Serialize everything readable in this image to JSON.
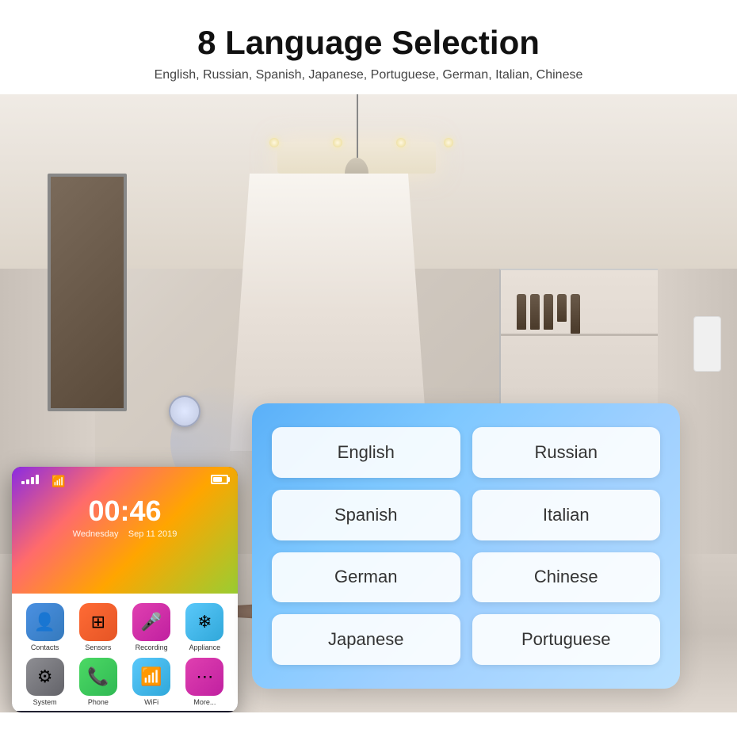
{
  "header": {
    "title": "8 Language Selection",
    "subtitle": "English, Russian, Spanish, Japanese, Portuguese, German, Italian, Chinese"
  },
  "languages": [
    {
      "id": "english",
      "label": "English"
    },
    {
      "id": "russian",
      "label": "Russian"
    },
    {
      "id": "spanish",
      "label": "Spanish"
    },
    {
      "id": "italian",
      "label": "Italian"
    },
    {
      "id": "german",
      "label": "German"
    },
    {
      "id": "chinese",
      "label": "Chinese"
    },
    {
      "id": "japanese",
      "label": "Japanese"
    },
    {
      "id": "portuguese",
      "label": "Portuguese"
    }
  ],
  "phone": {
    "time": "00:46",
    "date_line1": "Wednesday",
    "date_line2": "Sep 11 2019",
    "apps": [
      {
        "id": "contacts",
        "label": "Contacts",
        "icon": "👤"
      },
      {
        "id": "sensors",
        "label": "Sensors",
        "icon": "⊞"
      },
      {
        "id": "recording",
        "label": "Recording",
        "icon": "🎤"
      },
      {
        "id": "appliance",
        "label": "Appliance",
        "icon": "❄"
      },
      {
        "id": "system",
        "label": "System",
        "icon": "⚙"
      },
      {
        "id": "phone",
        "label": "Phone",
        "icon": "📞"
      },
      {
        "id": "wifi",
        "label": "WiFi",
        "icon": "📶"
      },
      {
        "id": "more",
        "label": "More...",
        "icon": "⋯"
      }
    ]
  }
}
